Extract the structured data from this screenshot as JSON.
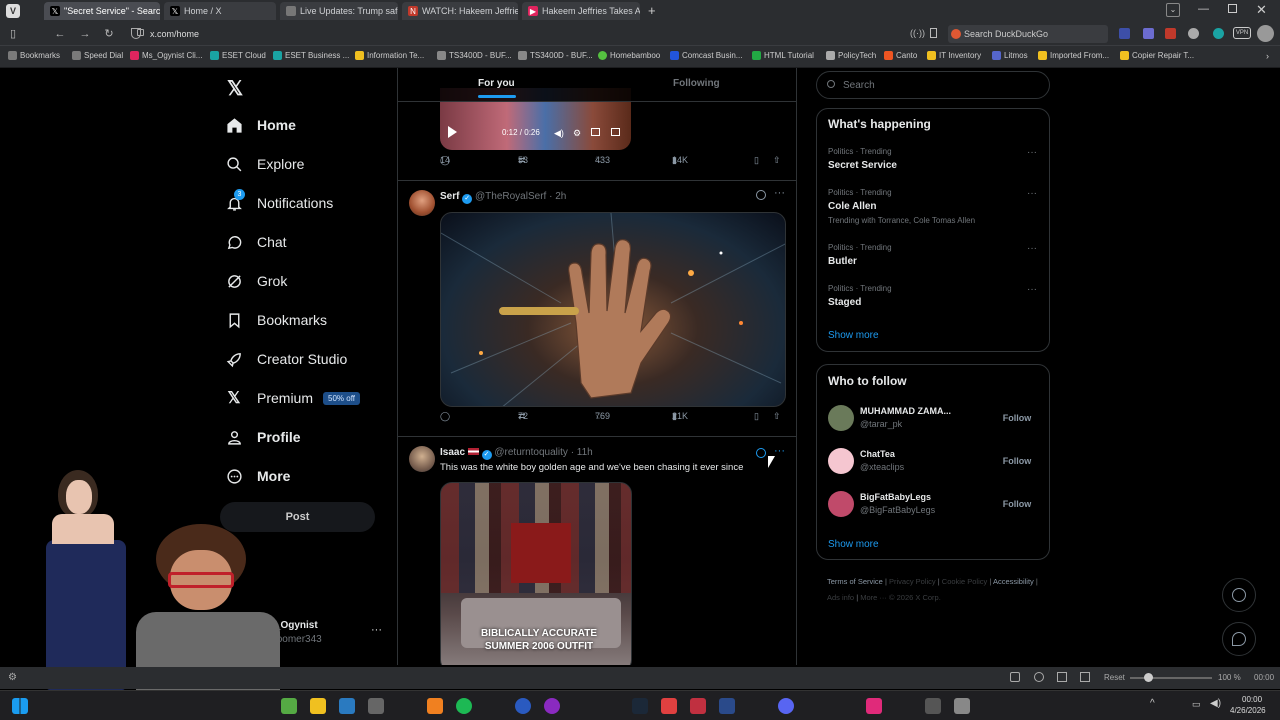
{
  "browser": {
    "tabs": [
      {
        "title": "\"Secret Service\" - Search / X",
        "icon": "x-icon",
        "color": "#000000"
      },
      {
        "title": "Home / X",
        "icon": "x-icon",
        "color": "#000000"
      },
      {
        "title": "Live Updates: Trump safe af",
        "icon": "globe-icon",
        "color": "#555555"
      },
      {
        "title": "WATCH: Hakeem Jeffries V",
        "icon": "news-icon",
        "color": "#c0392b"
      },
      {
        "title": "Hakeem Jeffries Takes Aim",
        "icon": "youtube-icon",
        "color": "#e0245e"
      }
    ],
    "url": "x.com/home",
    "search_placeholder": "Search DuckDuckGo",
    "bookmarks": [
      {
        "label": "Bookmarks",
        "color": "#7a7a7a"
      },
      {
        "label": "Speed Dial",
        "color": "#7a7a7a"
      },
      {
        "label": "Ms_Ogynist Cli...",
        "color": "#e0245e"
      },
      {
        "label": "ESET Cloud",
        "color": "#1aa3a3"
      },
      {
        "label": "ESET Business ...",
        "color": "#1aa3a3"
      },
      {
        "label": "Information Te...",
        "color": "#f0c020"
      },
      {
        "label": "TS3400D - BUF...",
        "color": "#888888"
      },
      {
        "label": "TS3400D - BUF...",
        "color": "#888888"
      },
      {
        "label": "Homebamboo",
        "color": "#55c040"
      },
      {
        "label": "Comcast Busin...",
        "color": "#2255dd"
      },
      {
        "label": "HTML Tutorial",
        "color": "#22aa44"
      },
      {
        "label": "PolicyTech",
        "color": "#aaaaaa"
      },
      {
        "label": "Canto",
        "color": "#ee5522"
      },
      {
        "label": "IT Inventory",
        "color": "#f0c020"
      },
      {
        "label": "Litmos",
        "color": "#5566cc"
      },
      {
        "label": "Imported From...",
        "color": "#f0c020"
      },
      {
        "label": "Copier Repair T...",
        "color": "#f0c020"
      }
    ]
  },
  "nav": {
    "items": [
      {
        "label": "Home",
        "icon": "home-icon",
        "bold": true
      },
      {
        "label": "Explore",
        "icon": "search-icon",
        "bold": false
      },
      {
        "label": "Notifications",
        "icon": "bell-icon",
        "bold": false
      },
      {
        "label": "Chat",
        "icon": "chat-icon",
        "bold": false
      },
      {
        "label": "Grok",
        "icon": "grok-icon",
        "bold": false
      },
      {
        "label": "Bookmarks",
        "icon": "bookmark-icon",
        "bold": false
      },
      {
        "label": "Creator Studio",
        "icon": "rocket-icon",
        "bold": false
      },
      {
        "label": "Premium",
        "icon": "x-logo-icon",
        "bold": false
      },
      {
        "label": "Profile",
        "icon": "person-icon",
        "bold": false
      },
      {
        "label": "More",
        "icon": "more-icon",
        "bold": false
      }
    ],
    "notification_count": "3",
    "premium_badge": "50% off",
    "post_label": "Post",
    "account_name": "Ms_Ogynist",
    "account_handle": "@doomer343"
  },
  "feed": {
    "tabs": [
      "For you",
      "Following"
    ],
    "video_time": "0:12 / 0:26",
    "tweet0": {
      "replies": "14",
      "reposts": "53",
      "likes": "433",
      "views": "14K"
    },
    "tweet1": {
      "name": "Serf",
      "handle": "@TheRoyalSerf",
      "time": "· 2h",
      "replies": "",
      "reposts": "72",
      "likes": "769",
      "views": "21K"
    },
    "tweet2": {
      "name": "Isaac",
      "handle": "@returntoquality",
      "time": "· 11h",
      "text": "This was the white boy golden age and we've been chasing it ever since",
      "image_caption": "BIBLICALLY ACCURATE SUMMER 2006 OUTFIT"
    }
  },
  "sidebar": {
    "search_placeholder": "Search",
    "happening_title": "What's happening",
    "trends": [
      {
        "meta": "Politics · Trending",
        "name": "Secret Service",
        "extra": ""
      },
      {
        "meta": "Politics · Trending",
        "name": "Cole Allen",
        "extra": "Trending with Torrance, Cole Tomas Allen"
      },
      {
        "meta": "Politics · Trending",
        "name": "Butler",
        "extra": ""
      },
      {
        "meta": "Politics · Trending",
        "name": "Staged",
        "extra": ""
      }
    ],
    "show_more": "Show more",
    "follow_title": "Who to follow",
    "follow": [
      {
        "name": "MUHAMMAD ZAMA...",
        "handle": "@tarar_pk",
        "button": "Follow"
      },
      {
        "name": "ChatTea",
        "handle": "@xteaclips",
        "button": "Follow"
      },
      {
        "name": "BigFatBabyLegs",
        "handle": "@BigFatBabyLegs",
        "button": "Follow"
      }
    ],
    "show_more_2": "Show more",
    "footer": [
      "Terms of Service",
      "Privacy Policy",
      "Cookie Policy",
      "Accessibility",
      "Ads info",
      "More ···",
      "© 2026 X Corp."
    ]
  },
  "statusbar": {
    "reset": "Reset",
    "zoom": "100 %",
    "time": "00:00"
  },
  "taskbar": {
    "time": "00:00",
    "date": "4/26/2026"
  }
}
